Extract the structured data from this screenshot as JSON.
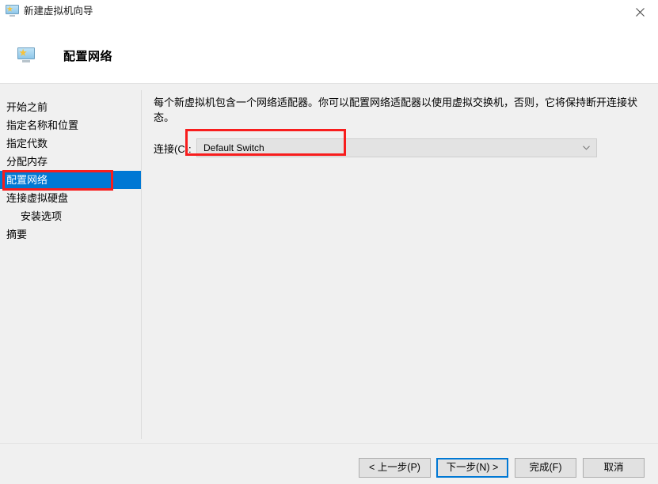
{
  "window": {
    "title": "新建虚拟机向导",
    "title_icon": "monitor-star-icon",
    "close_label": "✕"
  },
  "header": {
    "title": "配置网络",
    "icon": "monitor-star-icon"
  },
  "sidebar": {
    "items": [
      {
        "label": "开始之前",
        "selected": false,
        "indent": false
      },
      {
        "label": "指定名称和位置",
        "selected": false,
        "indent": false
      },
      {
        "label": "指定代数",
        "selected": false,
        "indent": false
      },
      {
        "label": "分配内存",
        "selected": false,
        "indent": false
      },
      {
        "label": "配置网络",
        "selected": true,
        "indent": false
      },
      {
        "label": "连接虚拟硬盘",
        "selected": false,
        "indent": false
      },
      {
        "label": "安装选项",
        "selected": false,
        "indent": true
      },
      {
        "label": "摘要",
        "selected": false,
        "indent": false
      }
    ]
  },
  "main": {
    "description": "每个新虚拟机包含一个网络适配器。你可以配置网络适配器以使用虚拟交换机，否则，它将保持断开连接状态。",
    "connection_label": "连接(C):",
    "connection_value": "Default Switch",
    "connection_arrow": "chevron-down-icon"
  },
  "footer": {
    "back": "< 上一步(P)",
    "next": "下一步(N) >",
    "finish": "完成(F)",
    "cancel": "取消"
  },
  "colors": {
    "selection_blue": "#0078d4",
    "annotation_red": "#f81d1d",
    "body_background": "#f0f0f0",
    "panel_white": "#ffffff"
  }
}
